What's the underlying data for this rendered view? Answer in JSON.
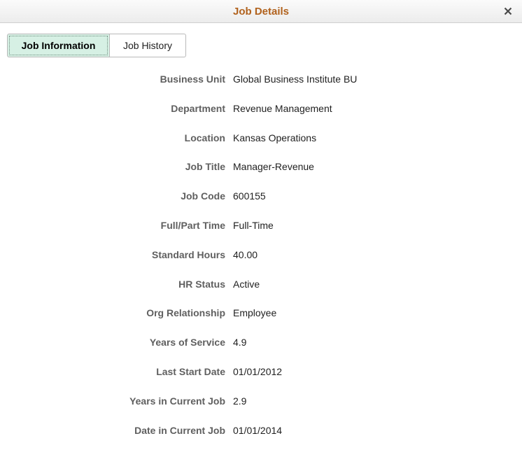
{
  "dialog": {
    "title": "Job Details",
    "close_icon": "close-icon"
  },
  "tabs": [
    {
      "label": "Job Information",
      "active": true
    },
    {
      "label": "Job History",
      "active": false
    }
  ],
  "fields": [
    {
      "label": "Business Unit",
      "value": "Global Business Institute BU"
    },
    {
      "label": "Department",
      "value": "Revenue Management"
    },
    {
      "label": "Location",
      "value": "Kansas Operations"
    },
    {
      "label": "Job Title",
      "value": "Manager-Revenue"
    },
    {
      "label": "Job Code",
      "value": "600155"
    },
    {
      "label": "Full/Part Time",
      "value": "Full-Time"
    },
    {
      "label": "Standard Hours",
      "value": "40.00"
    },
    {
      "label": "HR Status",
      "value": "Active"
    },
    {
      "label": "Org Relationship",
      "value": "Employee"
    },
    {
      "label": "Years of Service",
      "value": "4.9"
    },
    {
      "label": "Last Start Date",
      "value": "01/01/2012"
    },
    {
      "label": "Years in Current Job",
      "value": "2.9"
    },
    {
      "label": "Date in Current Job",
      "value": "01/01/2014"
    }
  ],
  "colors": {
    "title": "#b1621d",
    "active_tab_bg": "#d6f0e4",
    "label": "#5f5f5f"
  }
}
